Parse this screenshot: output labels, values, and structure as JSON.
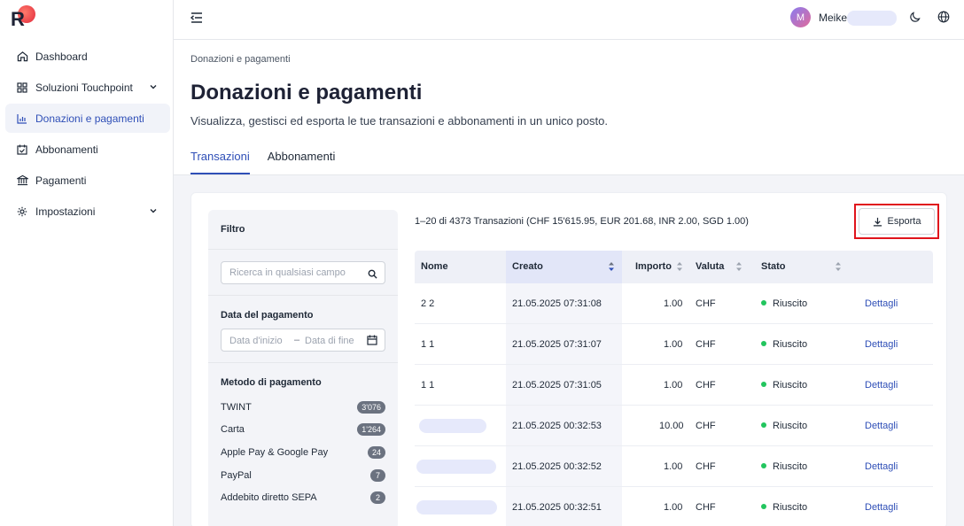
{
  "app": {
    "logo_letter": "R"
  },
  "sidebar": {
    "items": [
      {
        "label": "Dashboard",
        "icon": "home-icon"
      },
      {
        "label": "Soluzioni Touchpoint",
        "icon": "grid-icon",
        "expandable": true
      },
      {
        "label": "Donazioni e pagamenti",
        "icon": "bar-chart-icon",
        "active": true
      },
      {
        "label": "Abbonamenti",
        "icon": "calendar-check-icon"
      },
      {
        "label": "Pagamenti",
        "icon": "bank-icon"
      },
      {
        "label": "Impostazioni",
        "icon": "gear-icon",
        "expandable": true
      }
    ]
  },
  "header": {
    "avatar_initial": "M",
    "user_name": "Meike"
  },
  "page": {
    "breadcrumb": "Donazioni e pagamenti",
    "title": "Donazioni e pagamenti",
    "subtitle": "Visualizza, gestisci ed esporta le tue transazioni e abbonamenti in un unico posto.",
    "tabs": [
      {
        "label": "Transazioni",
        "active": true
      },
      {
        "label": "Abbonamenti",
        "active": false
      }
    ]
  },
  "filter": {
    "title": "Filtro",
    "search_placeholder": "Ricerca in qualsiasi campo",
    "date_section_label": "Data del pagamento",
    "date_start_placeholder": "Data d'inizio",
    "date_separator": "–",
    "date_end_placeholder": "Data di fine",
    "payment_method_label": "Metodo di pagamento",
    "payment_methods": [
      {
        "label": "TWINT",
        "count": "3'076"
      },
      {
        "label": "Carta",
        "count": "1'264"
      },
      {
        "label": "Apple Pay & Google Pay",
        "count": "24"
      },
      {
        "label": "PayPal",
        "count": "7"
      },
      {
        "label": "Addebito diretto SEPA",
        "count": "2"
      }
    ]
  },
  "results": {
    "summary": "1–20 di 4373 Transazioni (CHF 15'615.95, EUR 201.68, INR 2.00, SGD 1.00)",
    "export_label": "Esporta"
  },
  "table": {
    "columns": [
      "Nome",
      "Creato",
      "Importo",
      "Valuta",
      "Stato"
    ],
    "sorted_column": "Creato",
    "rows": [
      {
        "name": "2 2",
        "created": "21.05.2025 07:31:08",
        "amount": "1.00",
        "currency": "CHF",
        "status": "Riuscito",
        "action": "Dettagli"
      },
      {
        "name": "1 1",
        "created": "21.05.2025 07:31:07",
        "amount": "1.00",
        "currency": "CHF",
        "status": "Riuscito",
        "action": "Dettagli"
      },
      {
        "name": "1 1",
        "created": "21.05.2025 07:31:05",
        "amount": "1.00",
        "currency": "CHF",
        "status": "Riuscito",
        "action": "Dettagli"
      },
      {
        "name": "",
        "created": "21.05.2025 00:32:53",
        "amount": "10.00",
        "currency": "CHF",
        "status": "Riuscito",
        "action": "Dettagli"
      },
      {
        "name": "",
        "created": "21.05.2025 00:32:52",
        "amount": "1.00",
        "currency": "CHF",
        "status": "Riuscito",
        "action": "Dettagli"
      },
      {
        "name": "",
        "created": "21.05.2025 00:32:51",
        "amount": "1.00",
        "currency": "CHF",
        "status": "Riuscito",
        "action": "Dettagli"
      }
    ]
  },
  "colors": {
    "accent": "#2f4fb7",
    "success": "#22c55e",
    "highlight": "#e0141c"
  }
}
